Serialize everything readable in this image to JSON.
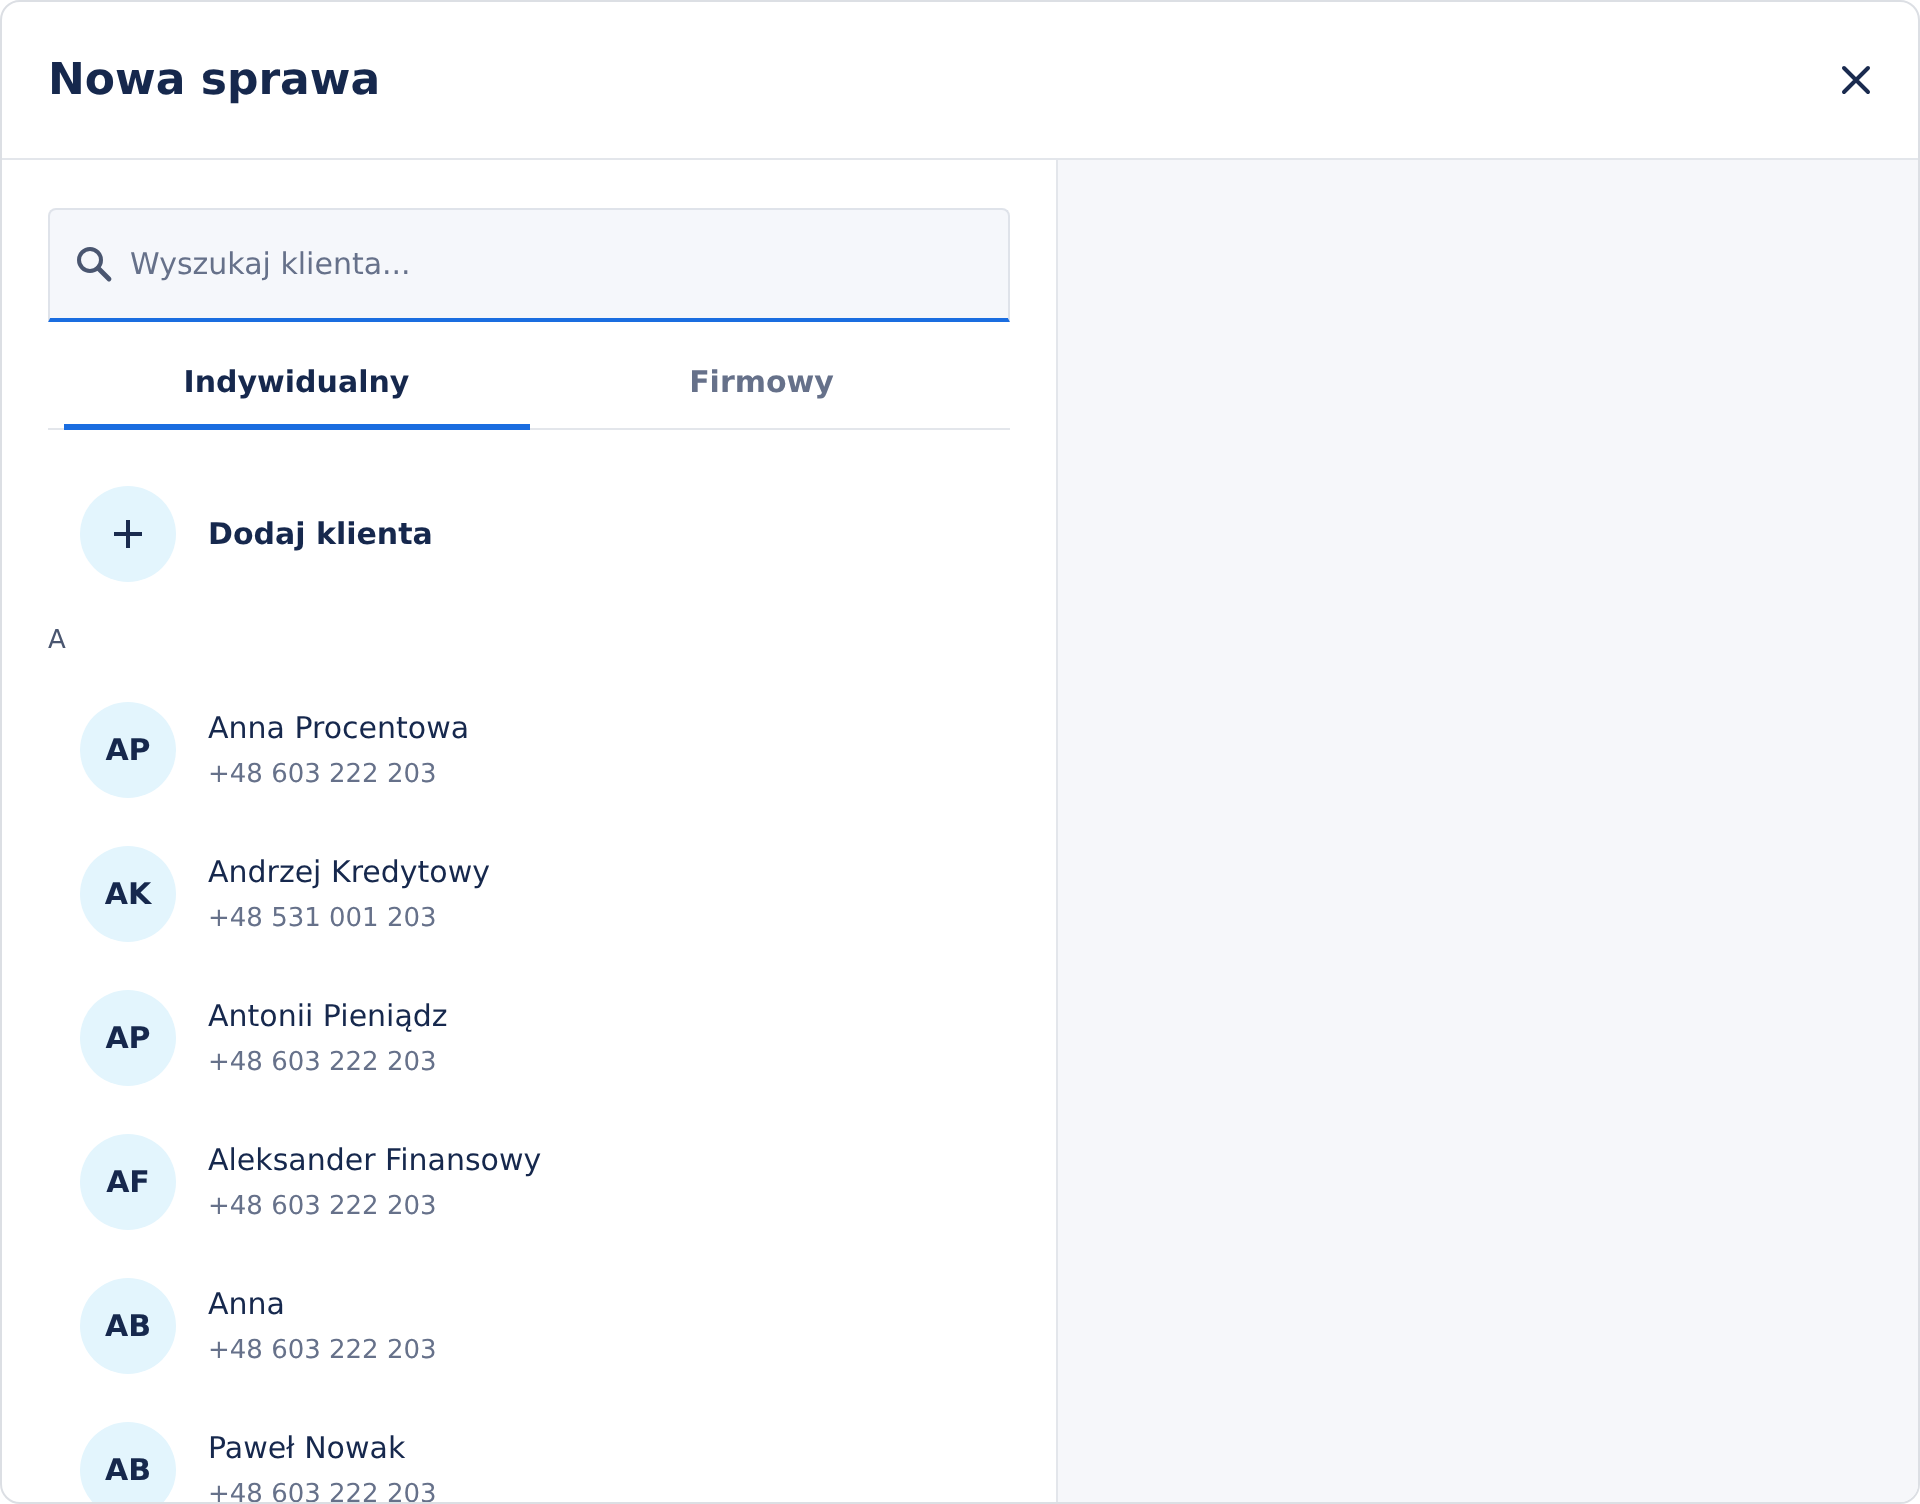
{
  "dialog": {
    "title": "Nowa sprawa"
  },
  "search": {
    "placeholder": "Wyszukaj klienta..."
  },
  "tabs": [
    {
      "label": "Indywidualny",
      "selected": true
    },
    {
      "label": "Firmowy",
      "selected": false
    }
  ],
  "add_client": {
    "label": "Dodaj klienta"
  },
  "groups": [
    {
      "letter": "A",
      "contacts": [
        {
          "initials": "AP",
          "name": "Anna Procentowa",
          "phone": "+48 603 222 203"
        },
        {
          "initials": "AK",
          "name": "Andrzej Kredytowy",
          "phone": "+48 531 001 203"
        },
        {
          "initials": "AP",
          "name": "Antonii Pieniądz",
          "phone": "+48 603 222 203"
        },
        {
          "initials": "AF",
          "name": "Aleksander Finansowy",
          "phone": "+48 603 222 203"
        },
        {
          "initials": "AB",
          "name": "Anna",
          "phone": "+48 603 222 203"
        },
        {
          "initials": "AB",
          "name": "Paweł Nowak",
          "phone": "+48 603 222 203"
        }
      ]
    }
  ]
}
